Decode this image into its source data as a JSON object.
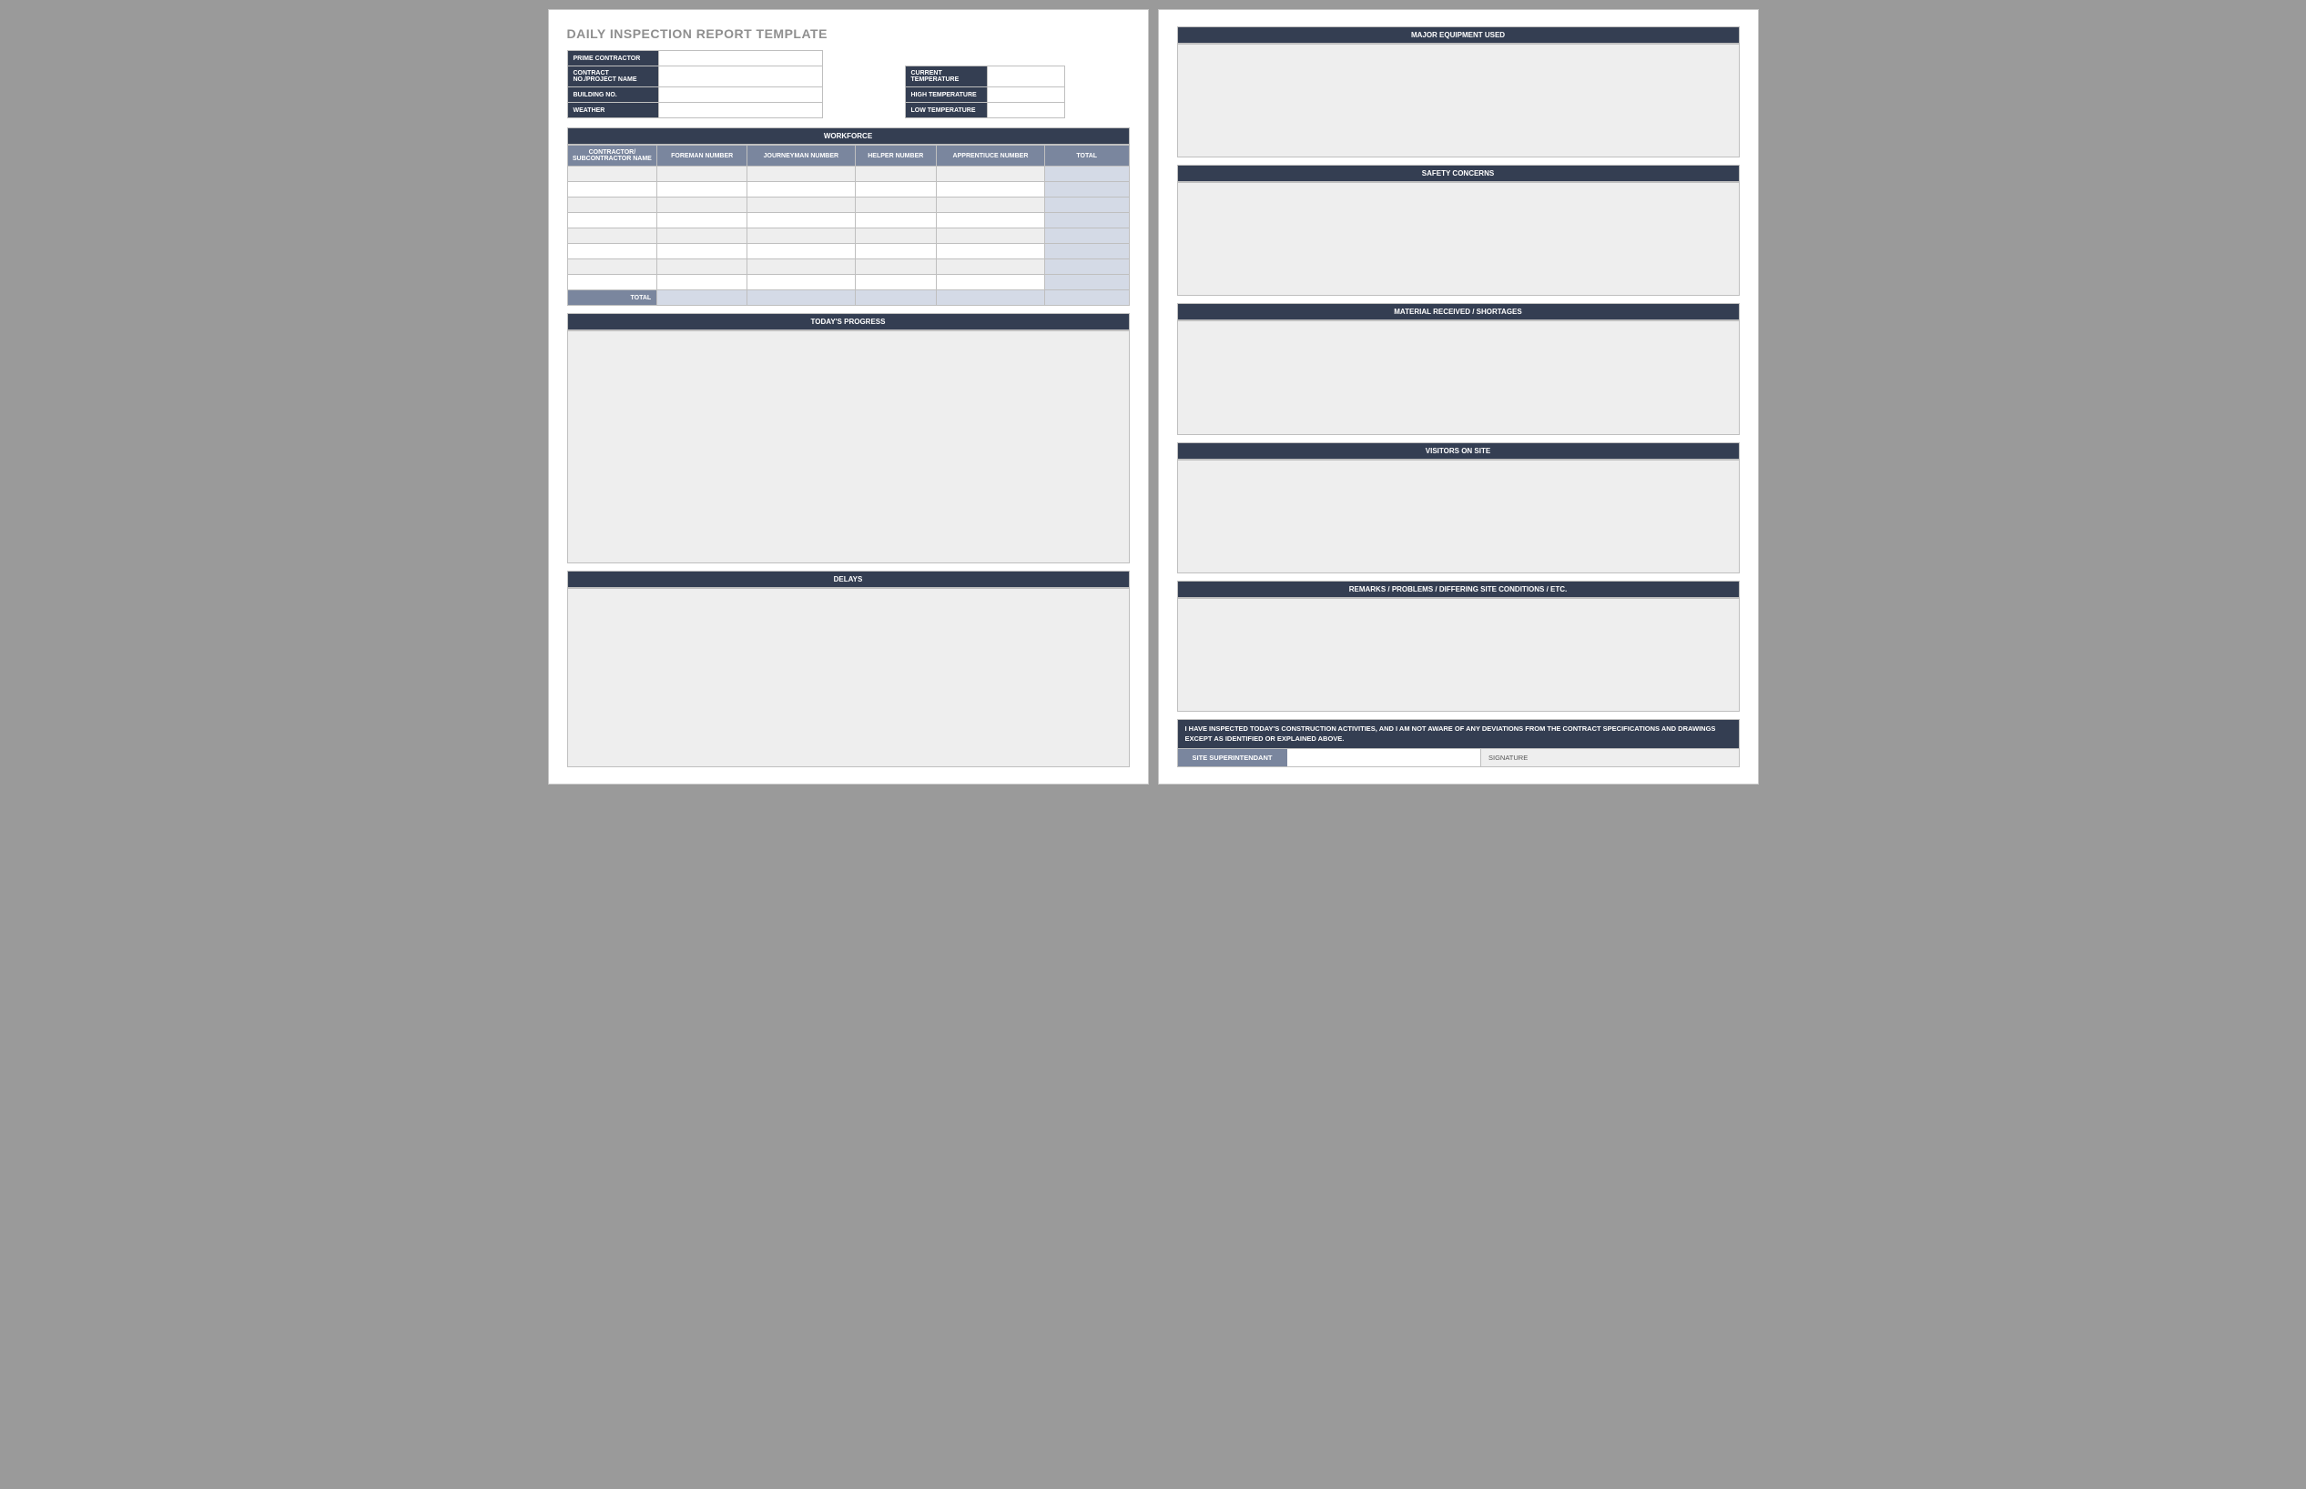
{
  "title": "DAILY INSPECTION REPORT TEMPLATE",
  "leftFields": [
    "PRIME CONTRACTOR",
    "CONTRACT NO./PROJECT NAME",
    "BUILDING NO.",
    "WEATHER"
  ],
  "rightFields": [
    "CURRENT TEMPERATURE",
    "HIGH TEMPERATURE",
    "LOW TEMPERATURE"
  ],
  "workforce": {
    "header": "WORKFORCE",
    "cols": [
      "CONTRACTOR/ SUBCONTRACTOR NAME",
      "FOREMAN NUMBER",
      "JOURNEYMAN NUMBER",
      "HELPER NUMBER",
      "APPRENTIUCE NUMBER",
      "TOTAL"
    ],
    "totalLabel": "TOTAL"
  },
  "sections_p1": {
    "progress": "TODAY'S PROGRESS",
    "delays": "DELAYS"
  },
  "sections_p2": {
    "equip": "MAJOR EQUIPMENT USED",
    "safety": "SAFETY CONCERNS",
    "material": "MATERIAL RECEIVED / SHORTAGES",
    "visitors": "VISITORS ON SITE",
    "remarks": "REMARKS / PROBLEMS / DIFFERING SITE CONDITIONS / ETC."
  },
  "certification": "I HAVE INSPECTED TODAY'S CONSTRUCTION ACTIVITIES, AND I AM NOT AWARE OF ANY DEVIATIONS FROM THE CONTRACT SPECIFICATIONS AND DRAWINGS EXCEPT AS IDENTIFIED OR EXPLAINED ABOVE.",
  "sig": {
    "super": "SITE SUPERINTENDANT",
    "signature": "SIGNATURE"
  }
}
